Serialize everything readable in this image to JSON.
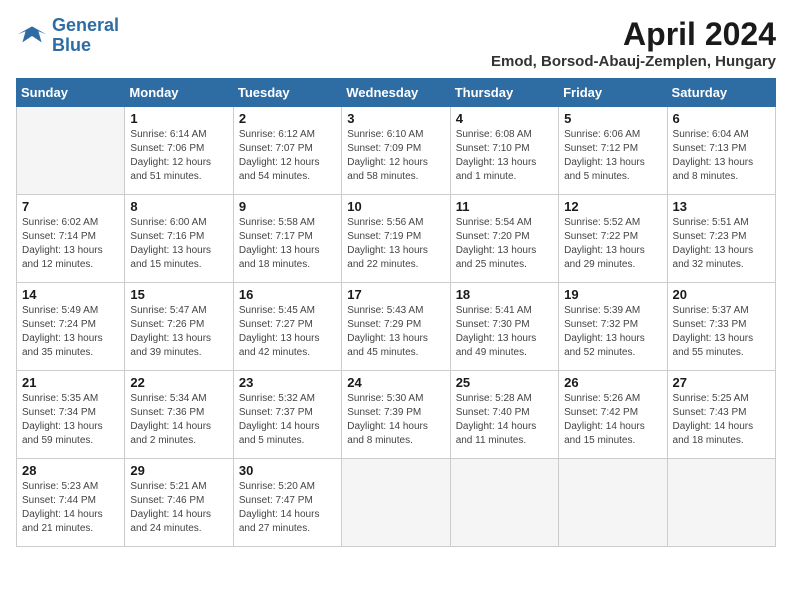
{
  "header": {
    "logo_line1": "General",
    "logo_line2": "Blue",
    "month_title": "April 2024",
    "location": "Emod, Borsod-Abauj-Zemplen, Hungary"
  },
  "weekdays": [
    "Sunday",
    "Monday",
    "Tuesday",
    "Wednesday",
    "Thursday",
    "Friday",
    "Saturday"
  ],
  "weeks": [
    [
      {
        "day": "",
        "info": ""
      },
      {
        "day": "1",
        "info": "Sunrise: 6:14 AM\nSunset: 7:06 PM\nDaylight: 12 hours\nand 51 minutes."
      },
      {
        "day": "2",
        "info": "Sunrise: 6:12 AM\nSunset: 7:07 PM\nDaylight: 12 hours\nand 54 minutes."
      },
      {
        "day": "3",
        "info": "Sunrise: 6:10 AM\nSunset: 7:09 PM\nDaylight: 12 hours\nand 58 minutes."
      },
      {
        "day": "4",
        "info": "Sunrise: 6:08 AM\nSunset: 7:10 PM\nDaylight: 13 hours\nand 1 minute."
      },
      {
        "day": "5",
        "info": "Sunrise: 6:06 AM\nSunset: 7:12 PM\nDaylight: 13 hours\nand 5 minutes."
      },
      {
        "day": "6",
        "info": "Sunrise: 6:04 AM\nSunset: 7:13 PM\nDaylight: 13 hours\nand 8 minutes."
      }
    ],
    [
      {
        "day": "7",
        "info": "Sunrise: 6:02 AM\nSunset: 7:14 PM\nDaylight: 13 hours\nand 12 minutes."
      },
      {
        "day": "8",
        "info": "Sunrise: 6:00 AM\nSunset: 7:16 PM\nDaylight: 13 hours\nand 15 minutes."
      },
      {
        "day": "9",
        "info": "Sunrise: 5:58 AM\nSunset: 7:17 PM\nDaylight: 13 hours\nand 18 minutes."
      },
      {
        "day": "10",
        "info": "Sunrise: 5:56 AM\nSunset: 7:19 PM\nDaylight: 13 hours\nand 22 minutes."
      },
      {
        "day": "11",
        "info": "Sunrise: 5:54 AM\nSunset: 7:20 PM\nDaylight: 13 hours\nand 25 minutes."
      },
      {
        "day": "12",
        "info": "Sunrise: 5:52 AM\nSunset: 7:22 PM\nDaylight: 13 hours\nand 29 minutes."
      },
      {
        "day": "13",
        "info": "Sunrise: 5:51 AM\nSunset: 7:23 PM\nDaylight: 13 hours\nand 32 minutes."
      }
    ],
    [
      {
        "day": "14",
        "info": "Sunrise: 5:49 AM\nSunset: 7:24 PM\nDaylight: 13 hours\nand 35 minutes."
      },
      {
        "day": "15",
        "info": "Sunrise: 5:47 AM\nSunset: 7:26 PM\nDaylight: 13 hours\nand 39 minutes."
      },
      {
        "day": "16",
        "info": "Sunrise: 5:45 AM\nSunset: 7:27 PM\nDaylight: 13 hours\nand 42 minutes."
      },
      {
        "day": "17",
        "info": "Sunrise: 5:43 AM\nSunset: 7:29 PM\nDaylight: 13 hours\nand 45 minutes."
      },
      {
        "day": "18",
        "info": "Sunrise: 5:41 AM\nSunset: 7:30 PM\nDaylight: 13 hours\nand 49 minutes."
      },
      {
        "day": "19",
        "info": "Sunrise: 5:39 AM\nSunset: 7:32 PM\nDaylight: 13 hours\nand 52 minutes."
      },
      {
        "day": "20",
        "info": "Sunrise: 5:37 AM\nSunset: 7:33 PM\nDaylight: 13 hours\nand 55 minutes."
      }
    ],
    [
      {
        "day": "21",
        "info": "Sunrise: 5:35 AM\nSunset: 7:34 PM\nDaylight: 13 hours\nand 59 minutes."
      },
      {
        "day": "22",
        "info": "Sunrise: 5:34 AM\nSunset: 7:36 PM\nDaylight: 14 hours\nand 2 minutes."
      },
      {
        "day": "23",
        "info": "Sunrise: 5:32 AM\nSunset: 7:37 PM\nDaylight: 14 hours\nand 5 minutes."
      },
      {
        "day": "24",
        "info": "Sunrise: 5:30 AM\nSunset: 7:39 PM\nDaylight: 14 hours\nand 8 minutes."
      },
      {
        "day": "25",
        "info": "Sunrise: 5:28 AM\nSunset: 7:40 PM\nDaylight: 14 hours\nand 11 minutes."
      },
      {
        "day": "26",
        "info": "Sunrise: 5:26 AM\nSunset: 7:42 PM\nDaylight: 14 hours\nand 15 minutes."
      },
      {
        "day": "27",
        "info": "Sunrise: 5:25 AM\nSunset: 7:43 PM\nDaylight: 14 hours\nand 18 minutes."
      }
    ],
    [
      {
        "day": "28",
        "info": "Sunrise: 5:23 AM\nSunset: 7:44 PM\nDaylight: 14 hours\nand 21 minutes."
      },
      {
        "day": "29",
        "info": "Sunrise: 5:21 AM\nSunset: 7:46 PM\nDaylight: 14 hours\nand 24 minutes."
      },
      {
        "day": "30",
        "info": "Sunrise: 5:20 AM\nSunset: 7:47 PM\nDaylight: 14 hours\nand 27 minutes."
      },
      {
        "day": "",
        "info": ""
      },
      {
        "day": "",
        "info": ""
      },
      {
        "day": "",
        "info": ""
      },
      {
        "day": "",
        "info": ""
      }
    ]
  ]
}
